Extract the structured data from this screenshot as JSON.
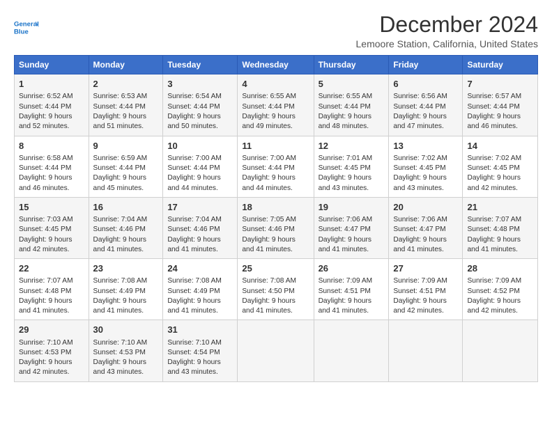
{
  "logo": {
    "line1": "General",
    "line2": "Blue"
  },
  "title": "December 2024",
  "subtitle": "Lemoore Station, California, United States",
  "days_of_week": [
    "Sunday",
    "Monday",
    "Tuesday",
    "Wednesday",
    "Thursday",
    "Friday",
    "Saturday"
  ],
  "weeks": [
    [
      {
        "day": 1,
        "sunrise": "6:52 AM",
        "sunset": "4:44 PM",
        "daylight": "9 hours and 52 minutes."
      },
      {
        "day": 2,
        "sunrise": "6:53 AM",
        "sunset": "4:44 PM",
        "daylight": "9 hours and 51 minutes."
      },
      {
        "day": 3,
        "sunrise": "6:54 AM",
        "sunset": "4:44 PM",
        "daylight": "9 hours and 50 minutes."
      },
      {
        "day": 4,
        "sunrise": "6:55 AM",
        "sunset": "4:44 PM",
        "daylight": "9 hours and 49 minutes."
      },
      {
        "day": 5,
        "sunrise": "6:55 AM",
        "sunset": "4:44 PM",
        "daylight": "9 hours and 48 minutes."
      },
      {
        "day": 6,
        "sunrise": "6:56 AM",
        "sunset": "4:44 PM",
        "daylight": "9 hours and 47 minutes."
      },
      {
        "day": 7,
        "sunrise": "6:57 AM",
        "sunset": "4:44 PM",
        "daylight": "9 hours and 46 minutes."
      }
    ],
    [
      {
        "day": 8,
        "sunrise": "6:58 AM",
        "sunset": "4:44 PM",
        "daylight": "9 hours and 46 minutes."
      },
      {
        "day": 9,
        "sunrise": "6:59 AM",
        "sunset": "4:44 PM",
        "daylight": "9 hours and 45 minutes."
      },
      {
        "day": 10,
        "sunrise": "7:00 AM",
        "sunset": "4:44 PM",
        "daylight": "9 hours and 44 minutes."
      },
      {
        "day": 11,
        "sunrise": "7:00 AM",
        "sunset": "4:44 PM",
        "daylight": "9 hours and 44 minutes."
      },
      {
        "day": 12,
        "sunrise": "7:01 AM",
        "sunset": "4:45 PM",
        "daylight": "9 hours and 43 minutes."
      },
      {
        "day": 13,
        "sunrise": "7:02 AM",
        "sunset": "4:45 PM",
        "daylight": "9 hours and 43 minutes."
      },
      {
        "day": 14,
        "sunrise": "7:02 AM",
        "sunset": "4:45 PM",
        "daylight": "9 hours and 42 minutes."
      }
    ],
    [
      {
        "day": 15,
        "sunrise": "7:03 AM",
        "sunset": "4:45 PM",
        "daylight": "9 hours and 42 minutes."
      },
      {
        "day": 16,
        "sunrise": "7:04 AM",
        "sunset": "4:46 PM",
        "daylight": "9 hours and 41 minutes."
      },
      {
        "day": 17,
        "sunrise": "7:04 AM",
        "sunset": "4:46 PM",
        "daylight": "9 hours and 41 minutes."
      },
      {
        "day": 18,
        "sunrise": "7:05 AM",
        "sunset": "4:46 PM",
        "daylight": "9 hours and 41 minutes."
      },
      {
        "day": 19,
        "sunrise": "7:06 AM",
        "sunset": "4:47 PM",
        "daylight": "9 hours and 41 minutes."
      },
      {
        "day": 20,
        "sunrise": "7:06 AM",
        "sunset": "4:47 PM",
        "daylight": "9 hours and 41 minutes."
      },
      {
        "day": 21,
        "sunrise": "7:07 AM",
        "sunset": "4:48 PM",
        "daylight": "9 hours and 41 minutes."
      }
    ],
    [
      {
        "day": 22,
        "sunrise": "7:07 AM",
        "sunset": "4:48 PM",
        "daylight": "9 hours and 41 minutes."
      },
      {
        "day": 23,
        "sunrise": "7:08 AM",
        "sunset": "4:49 PM",
        "daylight": "9 hours and 41 minutes."
      },
      {
        "day": 24,
        "sunrise": "7:08 AM",
        "sunset": "4:49 PM",
        "daylight": "9 hours and 41 minutes."
      },
      {
        "day": 25,
        "sunrise": "7:08 AM",
        "sunset": "4:50 PM",
        "daylight": "9 hours and 41 minutes."
      },
      {
        "day": 26,
        "sunrise": "7:09 AM",
        "sunset": "4:51 PM",
        "daylight": "9 hours and 41 minutes."
      },
      {
        "day": 27,
        "sunrise": "7:09 AM",
        "sunset": "4:51 PM",
        "daylight": "9 hours and 42 minutes."
      },
      {
        "day": 28,
        "sunrise": "7:09 AM",
        "sunset": "4:52 PM",
        "daylight": "9 hours and 42 minutes."
      }
    ],
    [
      {
        "day": 29,
        "sunrise": "7:10 AM",
        "sunset": "4:53 PM",
        "daylight": "9 hours and 42 minutes."
      },
      {
        "day": 30,
        "sunrise": "7:10 AM",
        "sunset": "4:53 PM",
        "daylight": "9 hours and 43 minutes."
      },
      {
        "day": 31,
        "sunrise": "7:10 AM",
        "sunset": "4:54 PM",
        "daylight": "9 hours and 43 minutes."
      },
      null,
      null,
      null,
      null
    ]
  ]
}
